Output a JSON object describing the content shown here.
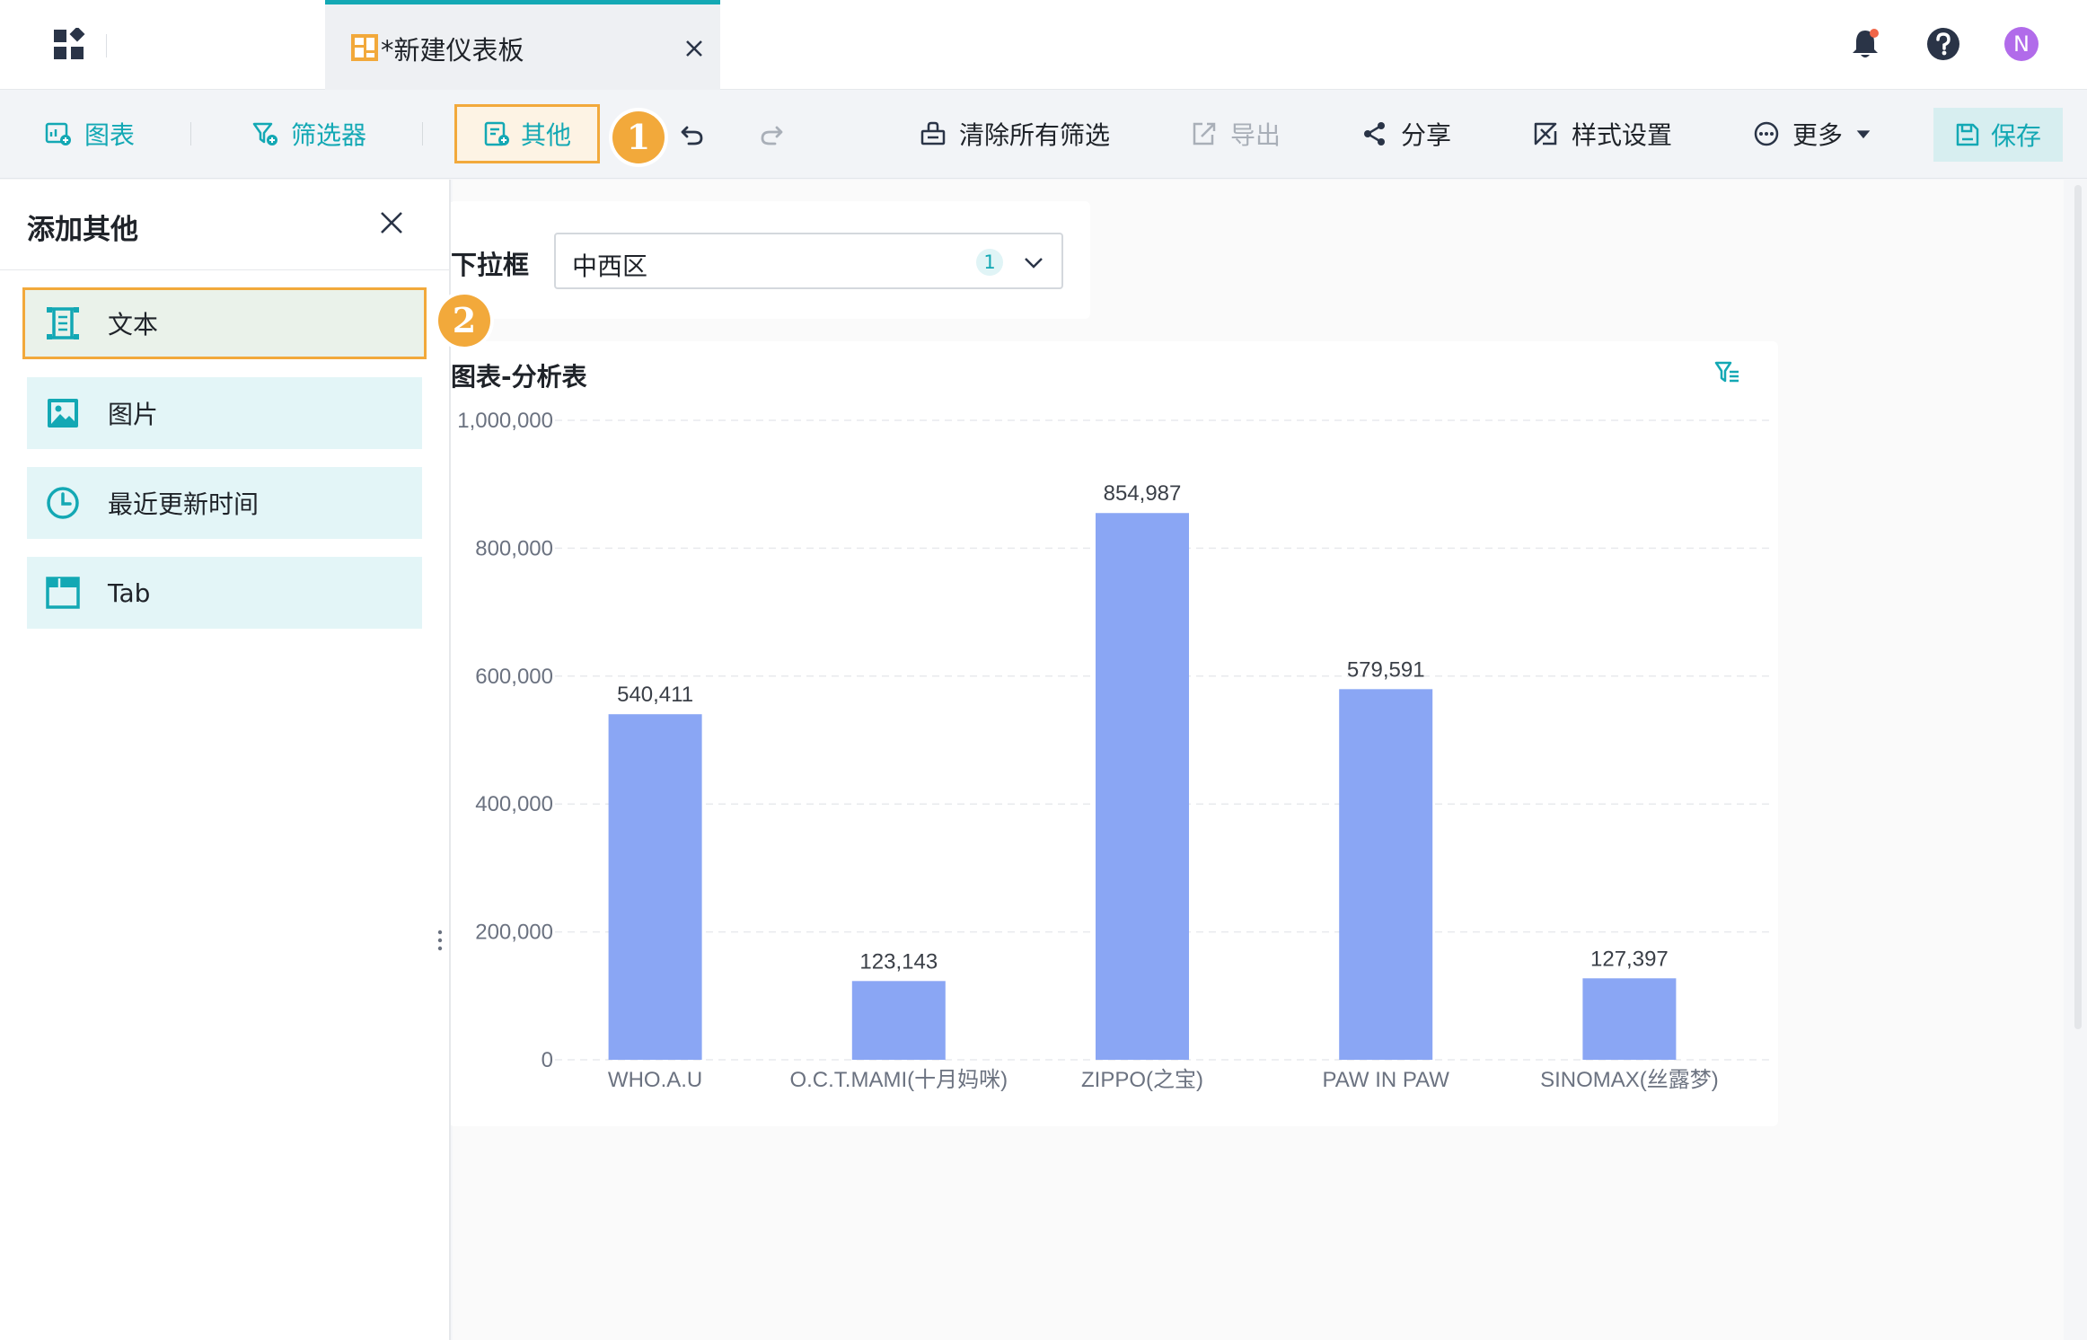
{
  "header": {
    "tab_title": "*新建仪表板",
    "avatar_initial": "N"
  },
  "toolbar": {
    "chart_label": "图表",
    "filter_label": "筛选器",
    "other_label": "其他",
    "step1": "1",
    "clear_filters_label": "清除所有筛选",
    "export_label": "导出",
    "share_label": "分享",
    "style_label": "样式设置",
    "more_label": "更多",
    "save_label": "保存"
  },
  "panel": {
    "title": "添加其他",
    "step2": "2",
    "items": [
      {
        "label": "文本",
        "icon": "text-icon"
      },
      {
        "label": "图片",
        "icon": "image-icon"
      },
      {
        "label": "最近更新时间",
        "icon": "clock-icon"
      },
      {
        "label": "Tab",
        "icon": "tab-icon"
      }
    ]
  },
  "filter": {
    "label": "下拉框",
    "value": "中西区",
    "count": "1"
  },
  "chart": {
    "title": "图表-分析表"
  },
  "colors": {
    "accent": "#13a8b4",
    "highlight": "#f2a93b",
    "bar": "#8aa6f4"
  },
  "chart_data": {
    "type": "bar",
    "title": "图表-分析表",
    "categories": [
      "WHO.A.U",
      "O.C.T.MAMI(十月妈咪)",
      "ZIPPO(之宝)",
      "PAW IN PAW",
      "SINOMAX(丝露梦)"
    ],
    "values": [
      540411,
      123143,
      854987,
      579591,
      127397
    ],
    "data_labels": [
      "540,411",
      "123,143",
      "854,987",
      "579,591",
      "127,397"
    ],
    "y_ticks": [
      0,
      200000,
      400000,
      600000,
      800000,
      1000000
    ],
    "y_tick_labels": [
      "0",
      "200,000",
      "400,000",
      "600,000",
      "800,000",
      "1,000,000"
    ],
    "ylim": [
      0,
      1000000
    ],
    "grid": true
  }
}
